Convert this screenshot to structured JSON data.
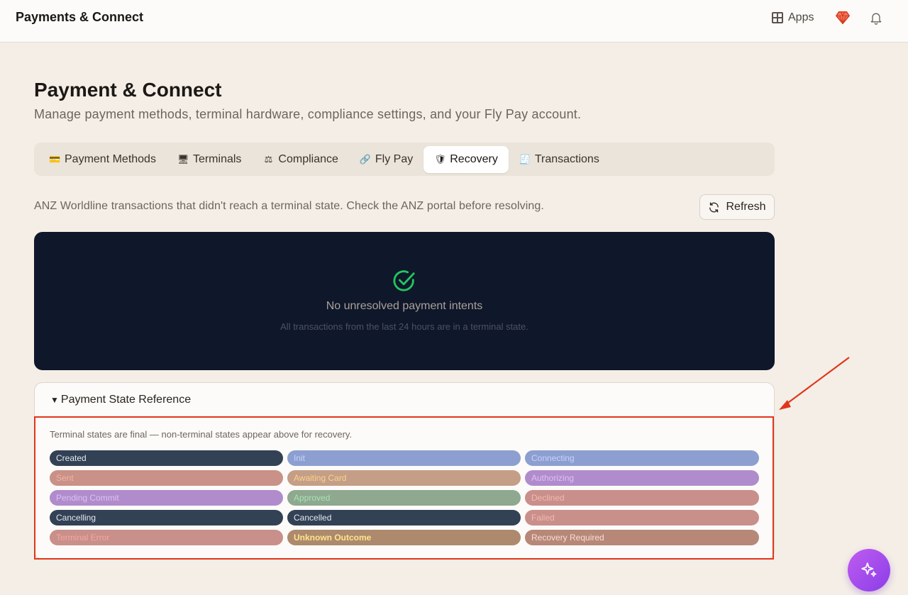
{
  "app": {
    "title": "Payments & Connect"
  },
  "topbar": {
    "apps_label": "Apps"
  },
  "page": {
    "title": "Payment & Connect",
    "subtitle": "Manage payment methods, terminal hardware, compliance settings, and your Fly Pay account."
  },
  "tabs": [
    {
      "icon": "💳",
      "label": "Payment Methods",
      "active": false
    },
    {
      "icon": "🖥",
      "label": "Terminals",
      "active": false
    },
    {
      "icon": "⚖",
      "label": "Compliance",
      "active": false
    },
    {
      "icon": "🔗",
      "label": "Fly Pay",
      "active": false
    },
    {
      "icon": "🛡",
      "label": "Recovery",
      "active": true
    },
    {
      "icon": "🧾",
      "label": "Transactions",
      "active": false
    }
  ],
  "recovery": {
    "description": "ANZ Worldline transactions that didn't reach a terminal state. Check the ANZ portal before resolving.",
    "refresh_label": "Refresh",
    "empty_title": "No unresolved payment intents",
    "empty_subtitle": "All transactions from the last 24 hours are in a terminal state."
  },
  "reference": {
    "summary": "Payment State Reference",
    "note": "Terminal states are final — non-terminal states appear above for recovery.",
    "states": [
      {
        "label": "Created",
        "bg": "#334155",
        "fg": "#e2e8f0",
        "bold": false
      },
      {
        "label": "Init",
        "bg": "#8c9fd0",
        "fg": "#c7d2fe",
        "bold": false
      },
      {
        "label": "Connecting",
        "bg": "#8c9fd0",
        "fg": "#c7d2fe",
        "bold": false
      },
      {
        "label": "Sent",
        "bg": "#c99187",
        "fg": "#f3b4a4",
        "bold": false
      },
      {
        "label": "Awaiting Card",
        "bg": "#c49e86",
        "fg": "#fbd38d",
        "bold": false
      },
      {
        "label": "Authorizing",
        "bg": "#b08ccc",
        "fg": "#ddc0f4",
        "bold": false
      },
      {
        "label": "Pending Commit",
        "bg": "#b08ccc",
        "fg": "#ddc0f4",
        "bold": false
      },
      {
        "label": "Approved",
        "bg": "#8fa890",
        "fg": "#a7e3b3",
        "bold": false
      },
      {
        "label": "Declined",
        "bg": "#c98f8a",
        "fg": "#f5b8b0",
        "bold": false
      },
      {
        "label": "Cancelling",
        "bg": "#334155",
        "fg": "#e2e8f0",
        "bold": false
      },
      {
        "label": "Cancelled",
        "bg": "#334155",
        "fg": "#e2e8f0",
        "bold": false
      },
      {
        "label": "Failed",
        "bg": "#c98f8a",
        "fg": "#f5b8b0",
        "bold": false
      },
      {
        "label": "Terminal Error",
        "bg": "#c98f8a",
        "fg": "#f5a8a0",
        "bold": false
      },
      {
        "label": "Unknown Outcome",
        "bg": "#ad8a6e",
        "fg": "#fde68a",
        "bold": true
      },
      {
        "label": "Recovery Required",
        "bg": "#b78878",
        "fg": "#f8ddd6",
        "bold": false
      }
    ]
  },
  "colors": {
    "background": "#f4eee7",
    "panel_dark": "#0f172a",
    "success": "#22c55e",
    "annotation": "#e0361b",
    "fab_gradient": [
      "#c05cf0",
      "#8a3ee8"
    ]
  },
  "icons": {
    "apps": "apps-grid-icon",
    "gem": "gem-icon",
    "bell": "bell-icon",
    "refresh": "refresh-icon",
    "success": "check-circle-icon",
    "fab": "sparkle-icon"
  }
}
